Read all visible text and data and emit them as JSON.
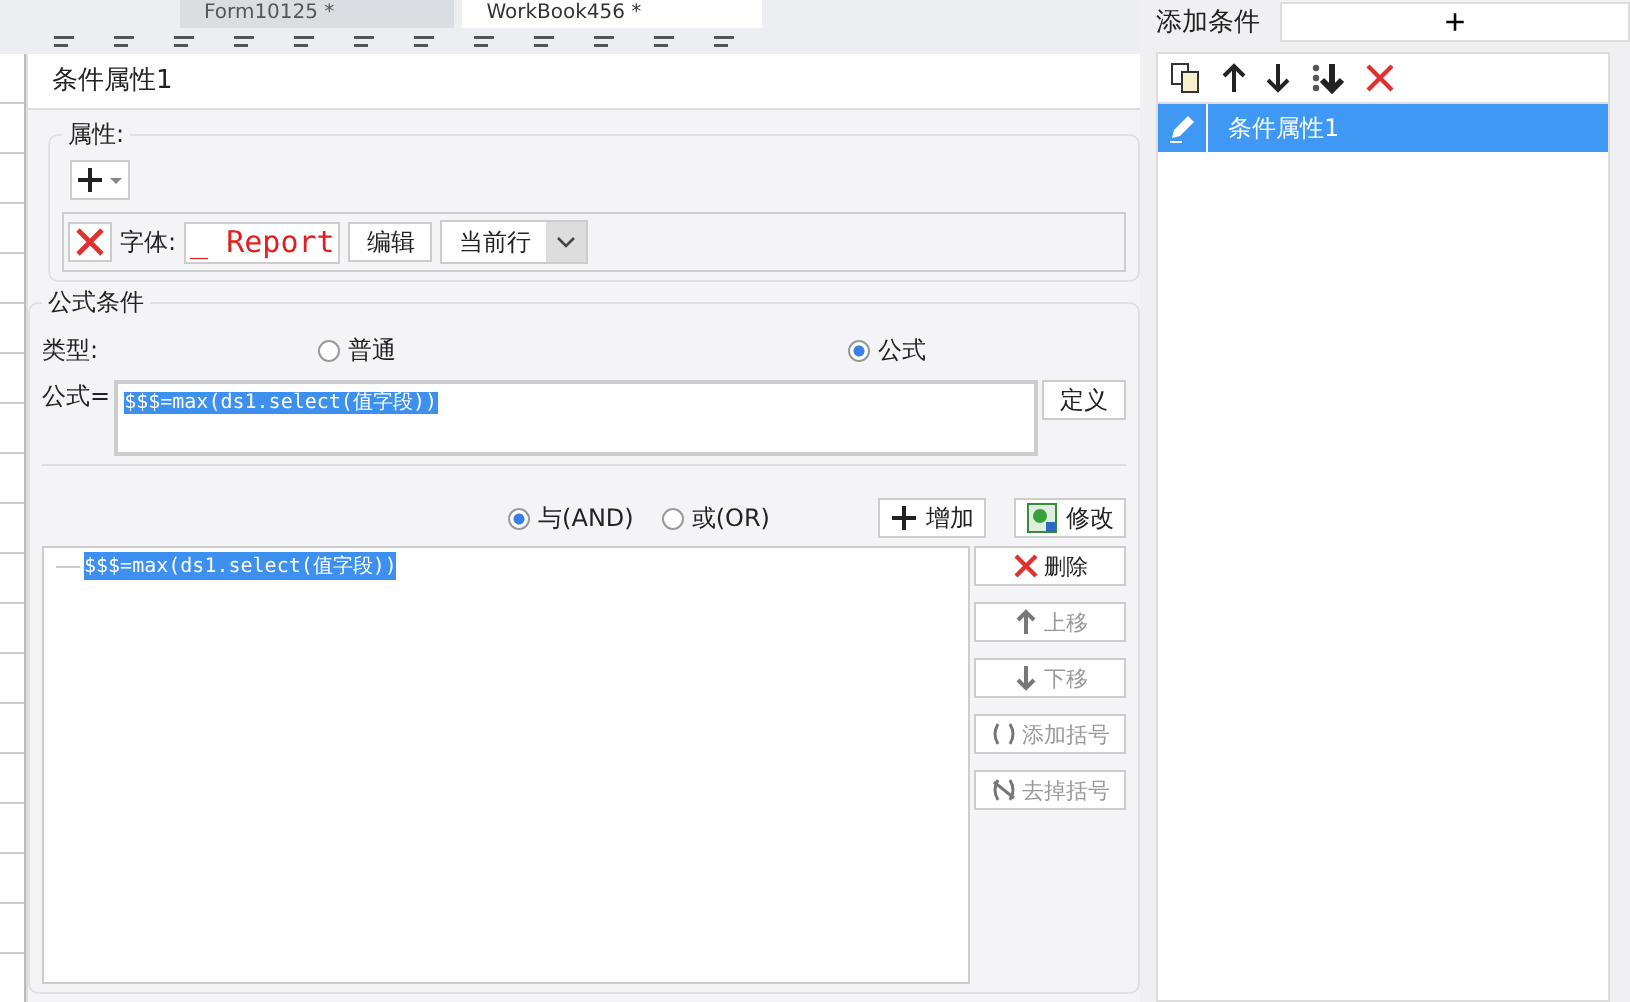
{
  "tabs": [
    {
      "label": "Form10125 *",
      "selected": false
    },
    {
      "label": "WorkBook456 *",
      "selected": true
    }
  ],
  "dialog": {
    "title": "条件属性1",
    "attributes": {
      "legend": "属性:",
      "rows": [
        {
          "label": "字体:",
          "value": "_ Report",
          "edit_button": "编辑",
          "scope": "当前行"
        }
      ]
    },
    "formula_condition": {
      "legend": "公式条件",
      "type_label": "类型:",
      "types": [
        {
          "label": "普通",
          "selected": false
        },
        {
          "label": "公式",
          "selected": true
        }
      ],
      "formula_label": "公式=",
      "formula": "$$$=max(ds1.select(值字段))",
      "define_button": "定义",
      "logic": [
        {
          "label": "与(AND)",
          "selected": true
        },
        {
          "label": "或(OR)",
          "selected": false
        }
      ],
      "add_button": "增加",
      "modify_button": "修改",
      "conditions": [
        {
          "text": "$$$=max(ds1.select(值字段))",
          "selected": true
        }
      ],
      "side_buttons": [
        {
          "label": "删除",
          "kind": "delete",
          "disabled": false
        },
        {
          "label": "上移",
          "kind": "up",
          "disabled": true
        },
        {
          "label": "下移",
          "kind": "down",
          "disabled": true
        },
        {
          "label": "添加括号",
          "kind": "bracket",
          "disabled": true
        },
        {
          "label": "去掉括号",
          "kind": "unbracket",
          "disabled": true
        }
      ]
    }
  },
  "side_panel": {
    "title": "添加条件",
    "add_button": "+",
    "items": [
      {
        "label": "条件属性1",
        "selected": true
      }
    ]
  }
}
